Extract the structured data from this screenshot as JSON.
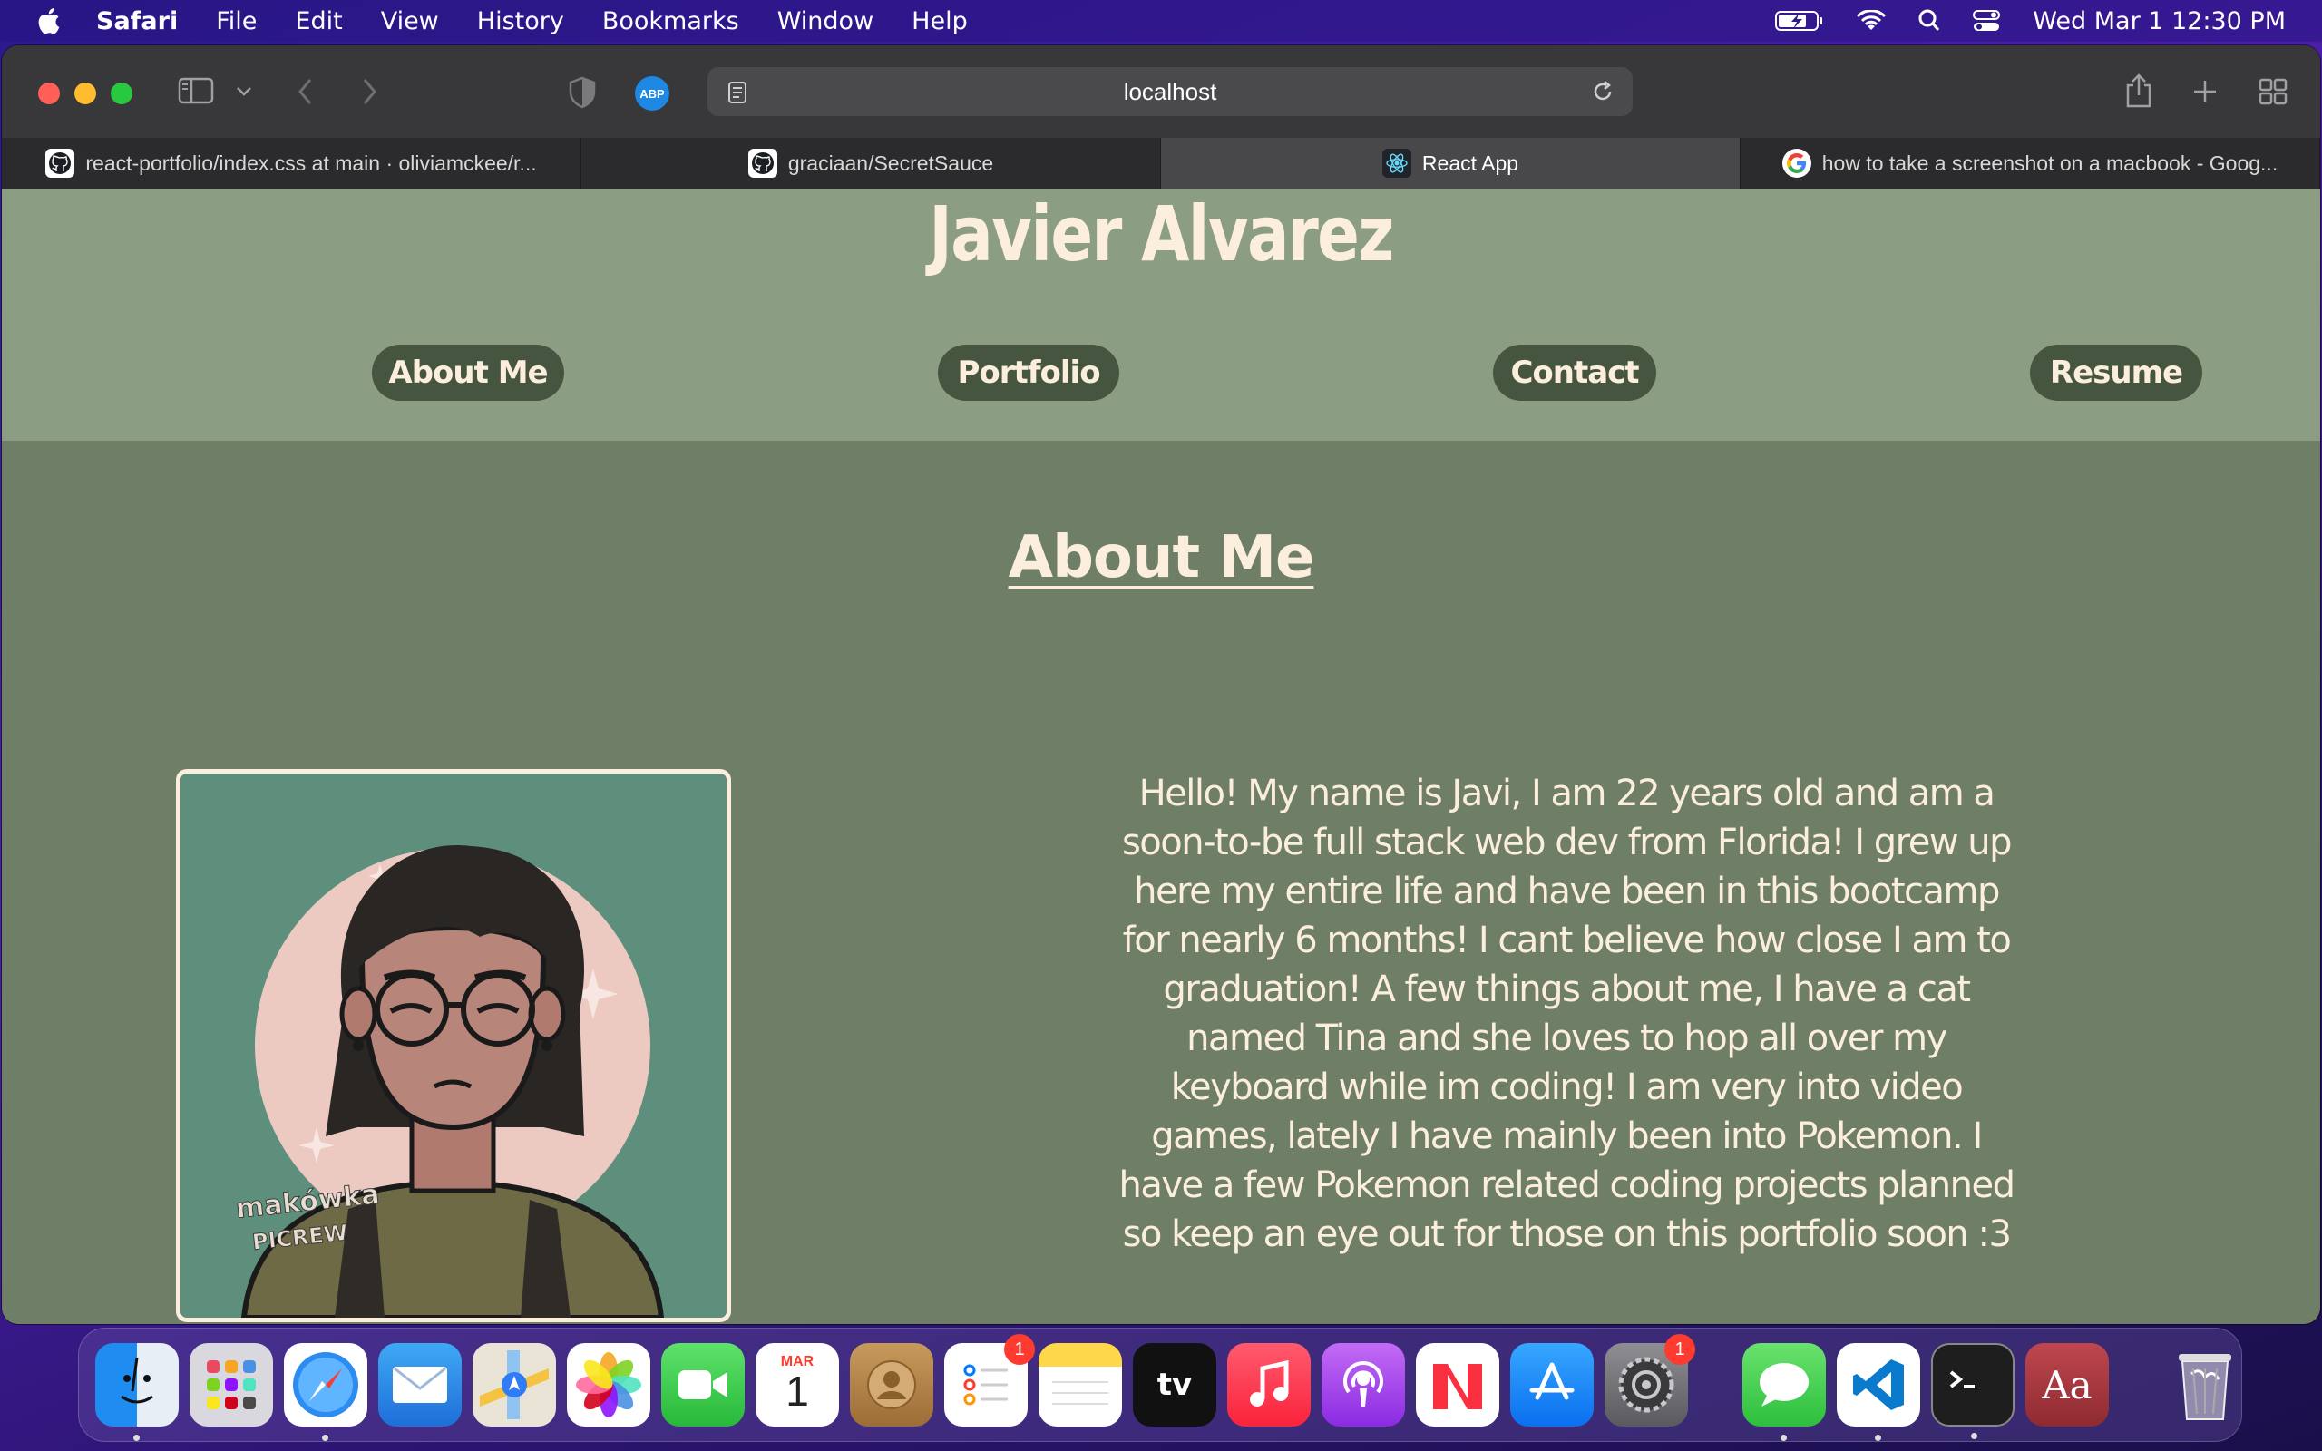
{
  "menubar": {
    "app_name": "Safari",
    "items": [
      "File",
      "Edit",
      "View",
      "History",
      "Bookmarks",
      "Window",
      "Help"
    ],
    "clock": "Wed Mar 1  12:30 PM"
  },
  "browser": {
    "url": "localhost",
    "adblock_label": "ABP",
    "tabs": [
      {
        "label": "react-portfolio/index.css at main · oliviamckee/r...",
        "icon": "github-icon"
      },
      {
        "label": "graciaan/SecretSauce",
        "icon": "github-icon"
      },
      {
        "label": "React App",
        "icon": "react-icon",
        "active": true
      },
      {
        "label": "how to take a screenshot on a macbook - Goog...",
        "icon": "google-icon"
      }
    ]
  },
  "site": {
    "title": "Javier Alvarez",
    "nav": [
      "About Me",
      "Portfolio",
      "Contact",
      "Resume"
    ],
    "section_title": "About Me",
    "avatar_watermark": "makówka picrew",
    "bio": "Hello! My name is Javi, I am 22 years old and am a soon-to-be full stack web dev from Florida! I grew up here my entire life and have been in this bootcamp for nearly 6 months! I cant believe how close I am to graduation! A few things about me, I have a cat named Tina and she loves to hop all over my keyboard while im coding! I am very into video games, lately I have mainly been into Pokemon. I have a few Pokemon related coding projects planned so keep an eye out for those on this portfolio soon :3"
  },
  "dock": {
    "calendar_month": "MAR",
    "calendar_day": "1",
    "reminders_badge": "1",
    "settings_badge": "1",
    "tv_label": "tv",
    "dictionary_label": "Aa"
  }
}
